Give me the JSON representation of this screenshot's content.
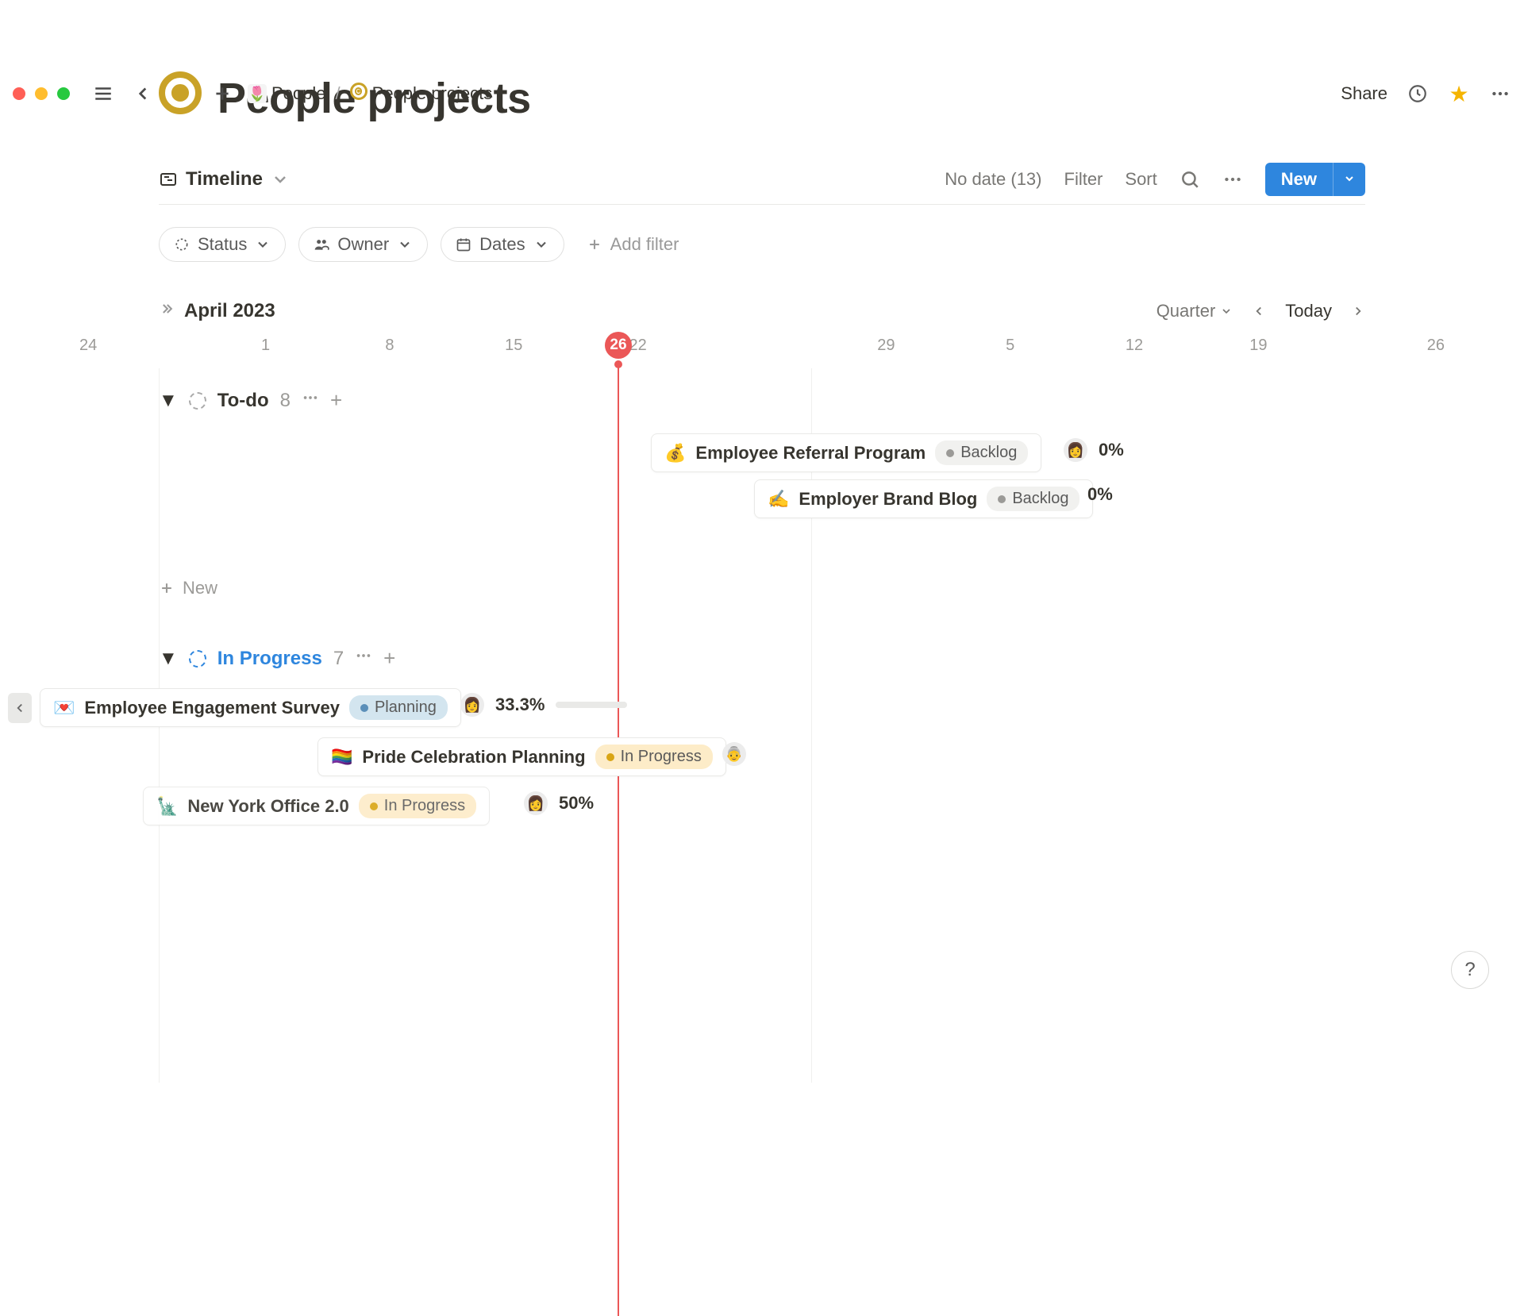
{
  "breadcrumb": {
    "parent_label": "People",
    "parent_emoji": "🌷",
    "separator": "/",
    "page_label": "People projects"
  },
  "header": {
    "share_label": "Share"
  },
  "page": {
    "title": "People projects"
  },
  "view": {
    "tab_label": "Timeline",
    "actions": {
      "no_date_label": "No date (13)",
      "filter_label": "Filter",
      "sort_label": "Sort",
      "new_label": "New"
    }
  },
  "filters": {
    "status_label": "Status",
    "owner_label": "Owner",
    "dates_label": "Dates",
    "add_filter_label": "Add filter"
  },
  "timeline": {
    "month_label": "April 2023",
    "range_label": "Quarter",
    "today_label": "Today",
    "today_value": "26",
    "ticks": [
      "24",
      "1",
      "8",
      "15",
      "22",
      "26",
      "29",
      "5",
      "12",
      "19",
      "26"
    ]
  },
  "groups": [
    {
      "name": "To-do",
      "count": "8",
      "new_label": "New",
      "cards": [
        {
          "emoji": "💰",
          "title": "Employee Referral Program",
          "status": "Backlog",
          "status_kind": "backlog",
          "percent": "0%",
          "has_avatar": true
        },
        {
          "emoji": "✍️",
          "title": "Employer Brand Blog",
          "status": "Backlog",
          "status_kind": "backlog",
          "percent": "0%",
          "has_avatar": false
        }
      ]
    },
    {
      "name": "In Progress",
      "count": "7",
      "cards": [
        {
          "emoji": "💌",
          "title": "Employee Engagement Survey",
          "status": "Planning",
          "status_kind": "planning",
          "percent": "33.3%",
          "has_avatar": true,
          "has_progress": true
        },
        {
          "emoji": "🏳️‍🌈",
          "title": "Pride Celebration Planning",
          "status": "In Progress",
          "status_kind": "inprogress",
          "has_avatar": true
        },
        {
          "emoji": "🗽",
          "title": "New York Office 2.0",
          "status": "In Progress",
          "status_kind": "inprogress",
          "percent": "50%",
          "has_avatar": true
        }
      ]
    }
  ],
  "help_label": "?"
}
